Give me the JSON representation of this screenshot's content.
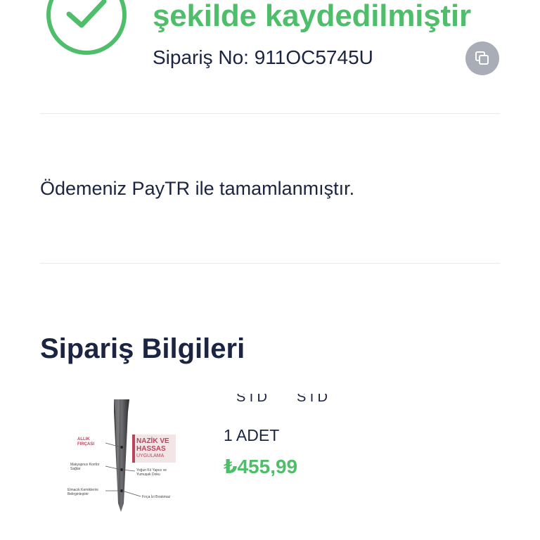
{
  "confirmation": {
    "headline": "şekilde kaydedilmiştir",
    "order_number": "Sipariş No: 911OC5745U"
  },
  "payment": {
    "message": "Ödemeniz PayTR ile tamamlanmıştır."
  },
  "order_info": {
    "title": "Sipariş Bilgileri",
    "product": {
      "variant_labels": [
        "STD",
        "STD"
      ],
      "quantity": "1 ADET",
      "price": "₺455,99",
      "image_text": {
        "left_top": "ALLIK FIRÇASI",
        "left_mid": "Makyajınızı Konfor Sağlar",
        "left_bottom": "Elmacık Kemiklerini Belirginleştirir",
        "box_title_1": "NAZİK VE",
        "box_title_2": "HASSAS",
        "box_sub": "UYGULAMA",
        "right_mid": "Yoğun Kıl Yapısı ve Yumuşak Doku",
        "right_bottom": "Fırça İzi Bırakmaz"
      }
    }
  },
  "colors": {
    "accent_green": "#4fbe6b",
    "text_dark": "#1b2440",
    "copy_button_bg": "#a9adb8"
  },
  "icons": [
    "check-icon",
    "copy-icon"
  ]
}
